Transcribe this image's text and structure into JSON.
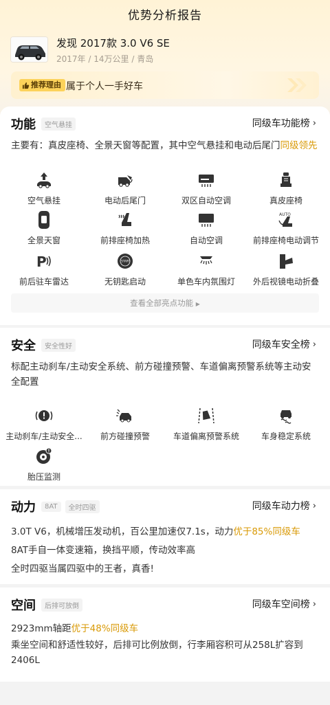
{
  "header": {
    "title": "优势分析报告"
  },
  "car": {
    "name": "发现 2017款 3.0 V6 SE",
    "year": "2017年",
    "mileage": "14万公里",
    "city": "青岛",
    "sep": "/"
  },
  "reason": {
    "badge": "推荐理由",
    "text": "属于个人一手好车"
  },
  "sections": {
    "function": {
      "title": "功能",
      "tag": "空气悬挂",
      "rank": "同级车功能榜",
      "desc_prefix": "主要有：真皮座椅、全景天窗等配置，其中空气悬挂和电动后尾门",
      "desc_highlight": "同级领先",
      "features": [
        {
          "label": "空气悬挂",
          "icon": "air-suspension-icon"
        },
        {
          "label": "电动后尾门",
          "icon": "power-tailgate-icon"
        },
        {
          "label": "双区自动空调",
          "icon": "dual-zone-ac-icon"
        },
        {
          "label": "真皮座椅",
          "icon": "leather-seat-icon"
        },
        {
          "label": "全景天窗",
          "icon": "panoramic-sunroof-icon"
        },
        {
          "label": "前排座椅加热",
          "icon": "seat-heating-icon"
        },
        {
          "label": "自动空调",
          "icon": "auto-ac-icon"
        },
        {
          "label": "前排座椅电动调节",
          "icon": "power-seat-icon"
        },
        {
          "label": "前后驻车雷达",
          "icon": "parking-radar-icon"
        },
        {
          "label": "无钥匙启动",
          "icon": "keyless-start-icon"
        },
        {
          "label": "单色车内氛围灯",
          "icon": "ambient-light-icon"
        },
        {
          "label": "外后视镜电动折叠",
          "icon": "mirror-fold-icon"
        }
      ],
      "view_all": "查看全部亮点功能"
    },
    "safety": {
      "title": "安全",
      "tag": "安全性好",
      "rank": "同级车安全榜",
      "desc": "标配主动刹车/主动安全系统、前方碰撞预警、车道偏离预警系统等主动安全配置",
      "features": [
        {
          "label": "主动刹车/主动安全...",
          "icon": "active-brake-icon"
        },
        {
          "label": "前方碰撞预警",
          "icon": "collision-warning-icon"
        },
        {
          "label": "车道偏离预警系统",
          "icon": "lane-departure-icon"
        },
        {
          "label": "车身稳定系统",
          "icon": "stability-control-icon"
        },
        {
          "label": "胎压监测",
          "icon": "tire-pressure-icon"
        }
      ]
    },
    "power": {
      "title": "动力",
      "tags": [
        "8AT",
        "全时四驱"
      ],
      "rank": "同级车动力榜",
      "line1_prefix": "3.0T V6，机械增压发动机，百公里加速仅7.1s，动力",
      "line1_highlight": "优于85%同级车",
      "line2": "8AT手自一体变速箱，换挡平顺，传动效率高",
      "line3": "全时四驱当属四驱中的王者，真香!"
    },
    "space": {
      "title": "空间",
      "tag": "后排可放倒",
      "rank": "同级车空间榜",
      "line1_prefix": "2923mm轴距",
      "line1_highlight": "优于48%同级车",
      "line2": "乘坐空间和舒适性较好，后排可比例放倒，行李厢容积可从258L扩容到2406L"
    }
  },
  "colors": {
    "accent": "#d99a07",
    "badge": "#fcd25a",
    "icon": "#333333"
  }
}
